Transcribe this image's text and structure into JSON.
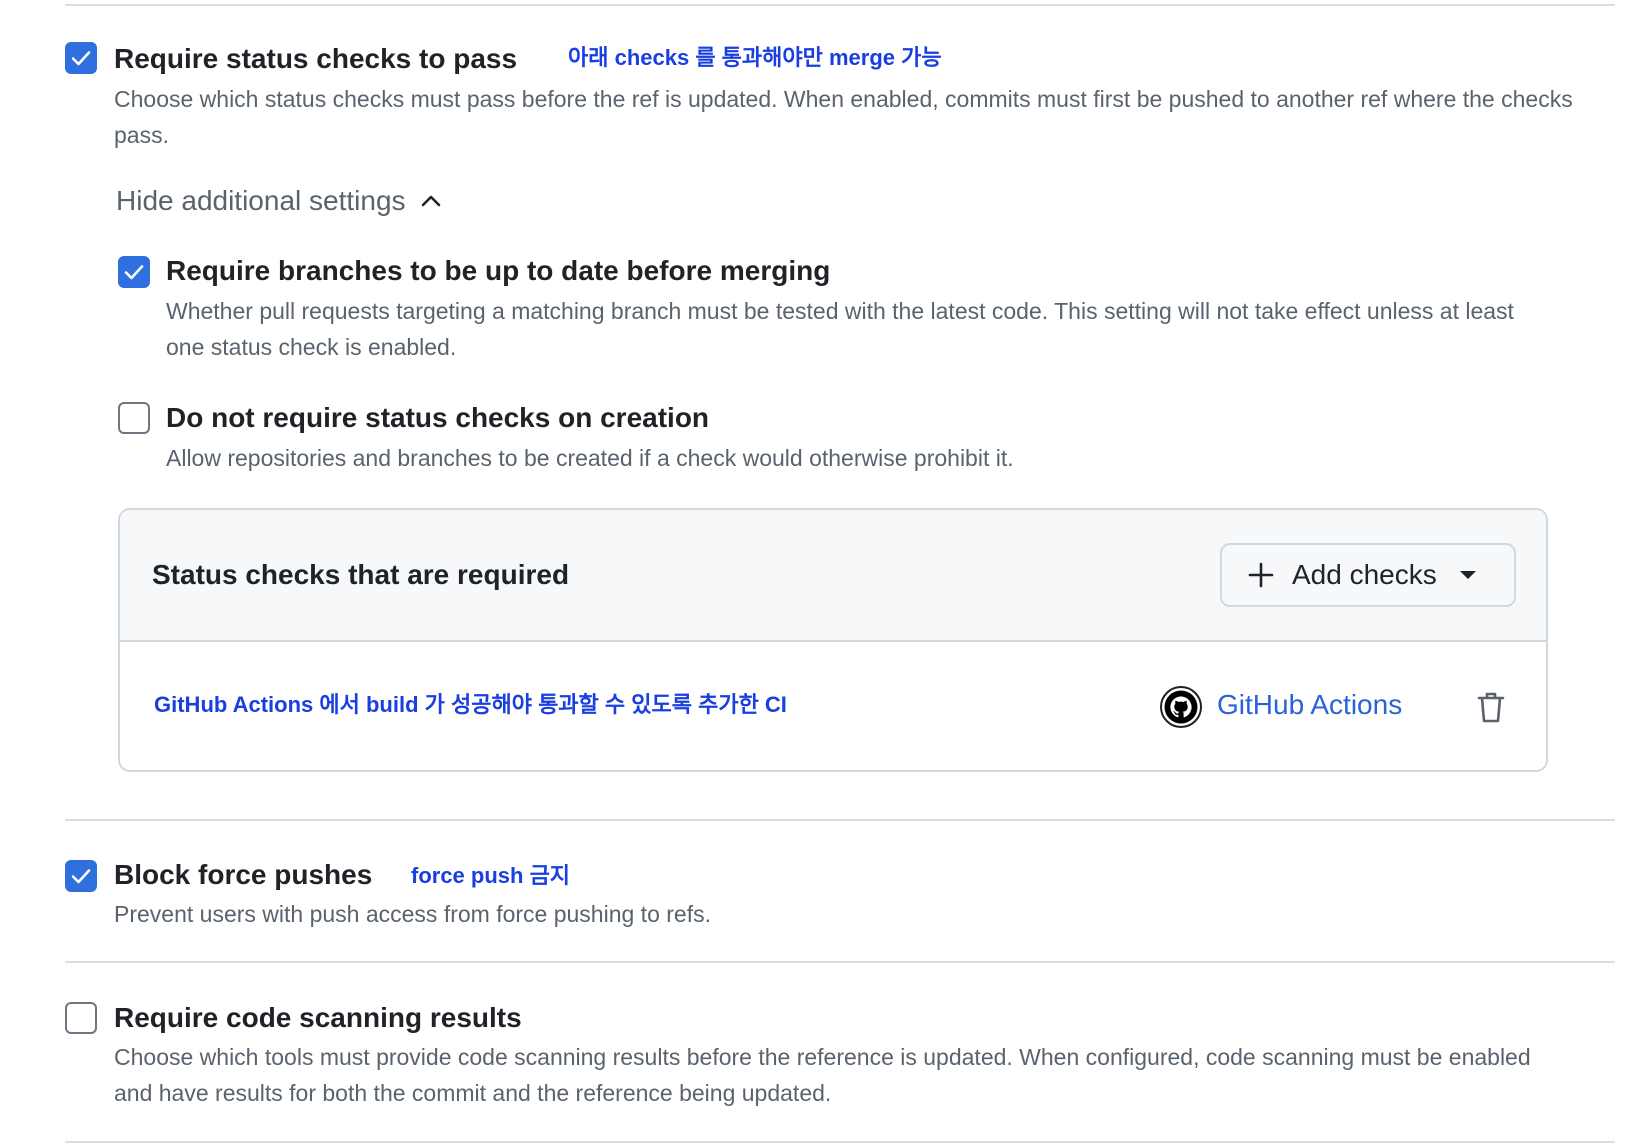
{
  "settings": {
    "status_checks": {
      "title": "Require status checks to pass",
      "checked": true,
      "note": "아래  checks 를 통과해야만 merge 가능",
      "description": "Choose which status checks must pass before the ref is updated. When enabled, commits must first be pushed to another ref where the checks pass.",
      "toggle_label": "Hide additional settings",
      "sub_options": [
        {
          "title": "Require branches to be up to date before merging",
          "checked": true,
          "description": "Whether pull requests targeting a matching branch must be tested with the latest code. This setting will not take effect unless at least one status check is enabled."
        },
        {
          "title": "Do not require status checks on creation",
          "checked": false,
          "description": "Allow repositories and branches to be created if a check would otherwise prohibit it."
        }
      ],
      "panel": {
        "title": "Status checks that are required",
        "add_button_label": "Add checks",
        "checks": [
          {
            "note": "GitHub Actions 에서 build 가 성공해야 통과할 수 있도록 추가한 CI",
            "app_name": "GitHub Actions",
            "app_icon": "github-icon"
          }
        ]
      }
    },
    "block_force_pushes": {
      "title": "Block force pushes",
      "checked": true,
      "note": "force push 금지",
      "description": "Prevent users with push access from force pushing to refs."
    },
    "code_scanning": {
      "title": "Require code scanning results",
      "checked": false,
      "description": "Choose which tools must provide code scanning results before the reference is updated. When configured, code scanning must be enabled and have results for both the commit and the reference being updated."
    }
  },
  "colors": {
    "accent": "#2f6fde",
    "annotation": "#1a3fe0",
    "link": "#2863d8",
    "muted_text": "#59636e",
    "border": "#d1d9e0"
  }
}
